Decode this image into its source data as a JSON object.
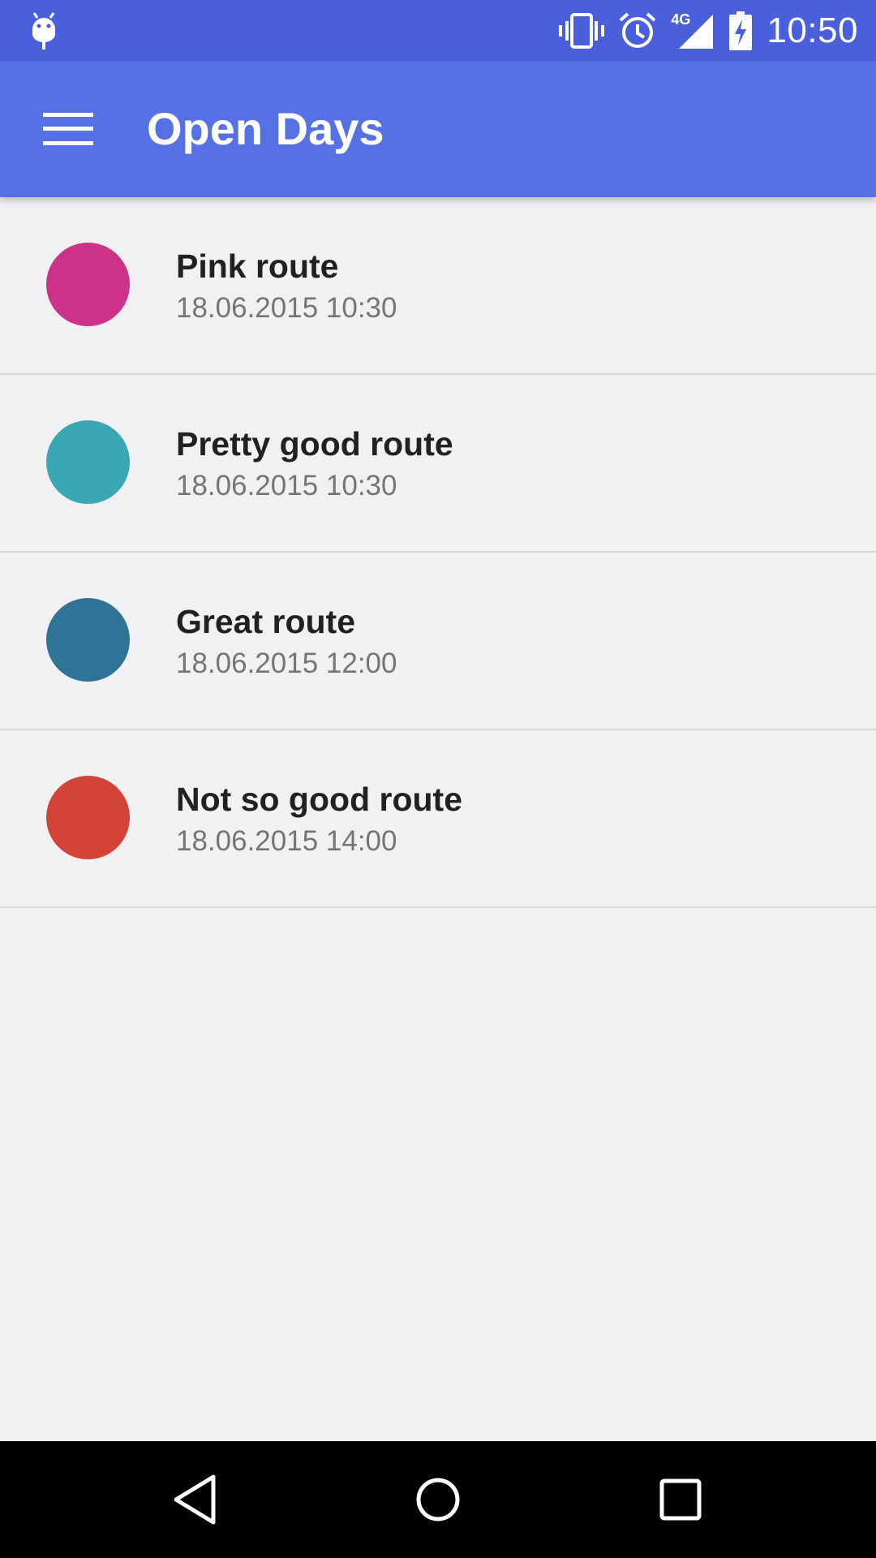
{
  "status_bar": {
    "time": "10:50",
    "network_label": "4G",
    "icons": [
      "android-debug-icon",
      "vibrate-icon",
      "alarm-icon",
      "signal-4g-icon",
      "battery-charging-icon"
    ]
  },
  "app_bar": {
    "title": "Open Days",
    "menu_icon": "hamburger-menu-icon"
  },
  "routes": [
    {
      "name": "Pink route",
      "datetime": "18.06.2015 10:30",
      "color": "#cc3388"
    },
    {
      "name": "Pretty good route",
      "datetime": "18.06.2015 10:30",
      "color": "#3aa8b4"
    },
    {
      "name": "Great route",
      "datetime": "18.06.2015 12:00",
      "color": "#2f7396"
    },
    {
      "name": "Not so good route",
      "datetime": "18.06.2015 14:00",
      "color": "#d24438"
    }
  ],
  "nav_bar": {
    "icons": [
      "back-icon",
      "home-icon",
      "recents-icon"
    ]
  },
  "colors": {
    "status_bar": "#4a5fdb",
    "app_bar": "#5571e3",
    "background": "#f1f0f3"
  }
}
